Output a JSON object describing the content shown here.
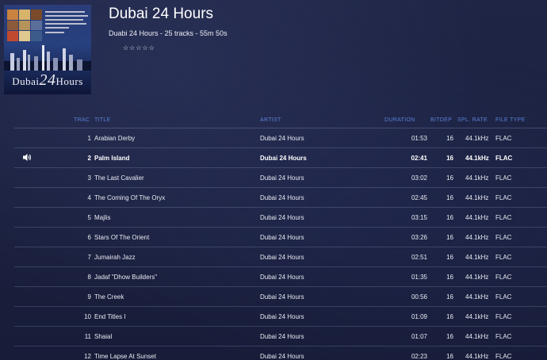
{
  "album": {
    "title": "Dubai 24 Hours",
    "subtitle": "Duabi 24 Hours  -  25 tracks - 55m 50s",
    "rating_stars": "☆☆☆☆☆",
    "cover": {
      "title_prefix": "Dubai",
      "title_number": "24",
      "title_suffix": "Hours"
    }
  },
  "columns": {
    "num": "TRAC",
    "title": "TITLE",
    "artist": "ARTIST",
    "duration": "DURATION",
    "bitdepth": "BITDEP",
    "samplerate": "SPL. RATE",
    "filetype": "FILE TYPE"
  },
  "now_playing_icon": "speaker-icon",
  "colors": {
    "background": "#1b2140",
    "header_accent": "#5b7fd6"
  },
  "tracks": [
    {
      "num": "1",
      "title": "Arabian Derby",
      "artist": "Dubai 24 Hours",
      "duration": "01:53",
      "bitdepth": "16",
      "samplerate": "44.1kHz",
      "filetype": "FLAC",
      "playing": false
    },
    {
      "num": "2",
      "title": "Palm Island",
      "artist": "Dubai 24 Hours",
      "duration": "02:41",
      "bitdepth": "16",
      "samplerate": "44.1kHz",
      "filetype": "FLAC",
      "playing": true
    },
    {
      "num": "3",
      "title": "The Last Cavalier",
      "artist": "Dubai 24 Hours",
      "duration": "03:02",
      "bitdepth": "16",
      "samplerate": "44.1kHz",
      "filetype": "FLAC",
      "playing": false
    },
    {
      "num": "4",
      "title": "The Coming Of The Oryx",
      "artist": "Dubai 24 Hours",
      "duration": "02:45",
      "bitdepth": "16",
      "samplerate": "44.1kHz",
      "filetype": "FLAC",
      "playing": false
    },
    {
      "num": "5",
      "title": "Majlis",
      "artist": "Dubai 24 Hours",
      "duration": "03:15",
      "bitdepth": "16",
      "samplerate": "44.1kHz",
      "filetype": "FLAC",
      "playing": false
    },
    {
      "num": "6",
      "title": "Stars Of The Orient",
      "artist": "Dubai 24 Hours",
      "duration": "03:26",
      "bitdepth": "16",
      "samplerate": "44.1kHz",
      "filetype": "FLAC",
      "playing": false
    },
    {
      "num": "7",
      "title": "Jumairah Jazz",
      "artist": "Dubai 24 Hours",
      "duration": "02:51",
      "bitdepth": "16",
      "samplerate": "44.1kHz",
      "filetype": "FLAC",
      "playing": false
    },
    {
      "num": "8",
      "title": "Jadaf \"Dhow Builders\"",
      "artist": "Dubai 24 Hours",
      "duration": "01:35",
      "bitdepth": "16",
      "samplerate": "44.1kHz",
      "filetype": "FLAC",
      "playing": false
    },
    {
      "num": "9",
      "title": "The Creek",
      "artist": "Dubai 24 Hours",
      "duration": "00:56",
      "bitdepth": "16",
      "samplerate": "44.1kHz",
      "filetype": "FLAC",
      "playing": false
    },
    {
      "num": "10",
      "title": "End Titles I",
      "artist": "Dubai 24 Hours",
      "duration": "01:09",
      "bitdepth": "16",
      "samplerate": "44.1kHz",
      "filetype": "FLAC",
      "playing": false
    },
    {
      "num": "11",
      "title": "Shaial",
      "artist": "Dubai 24 Hours",
      "duration": "01:07",
      "bitdepth": "16",
      "samplerate": "44.1kHz",
      "filetype": "FLAC",
      "playing": false
    },
    {
      "num": "12",
      "title": "Time Lapse At Sunset",
      "artist": "Dubai 24 Hours",
      "duration": "02:23",
      "bitdepth": "16",
      "samplerate": "44.1kHz",
      "filetype": "FLAC",
      "playing": false
    }
  ]
}
